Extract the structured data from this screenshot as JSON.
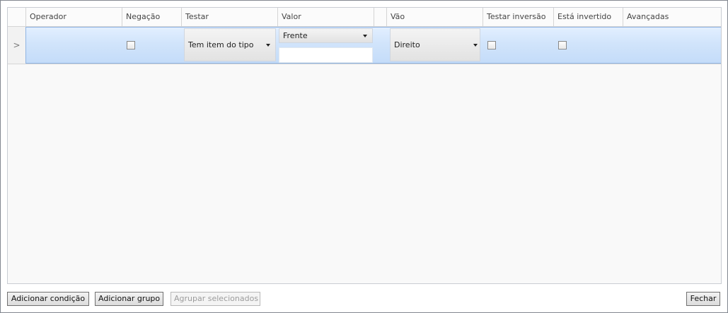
{
  "columns": {
    "operador": "Operador",
    "negacao": "Negação",
    "testar": "Testar",
    "valor": "Valor",
    "vao": "Vão",
    "testar_inversao": "Testar inversão",
    "esta_invertido": "Está invertido",
    "avancadas": "Avançadas"
  },
  "rows": [
    {
      "indicator": ">",
      "operador": "",
      "negacao_checked": false,
      "testar": "Tem item do tipo",
      "valor": "Frente",
      "valor_text": "",
      "vao": "Direito",
      "testar_inversao_checked": false,
      "esta_invertido_checked": false
    }
  ],
  "buttons": {
    "add_condition": "Adicionar condição",
    "add_group": "Adicionar grupo",
    "group_selected": "Agrupar selecionados",
    "close": "Fechar"
  },
  "colors": {
    "selected_row_top": "#e2efff",
    "selected_row_bottom": "#c4dcf9",
    "selected_row_border": "#8fb4e3"
  }
}
